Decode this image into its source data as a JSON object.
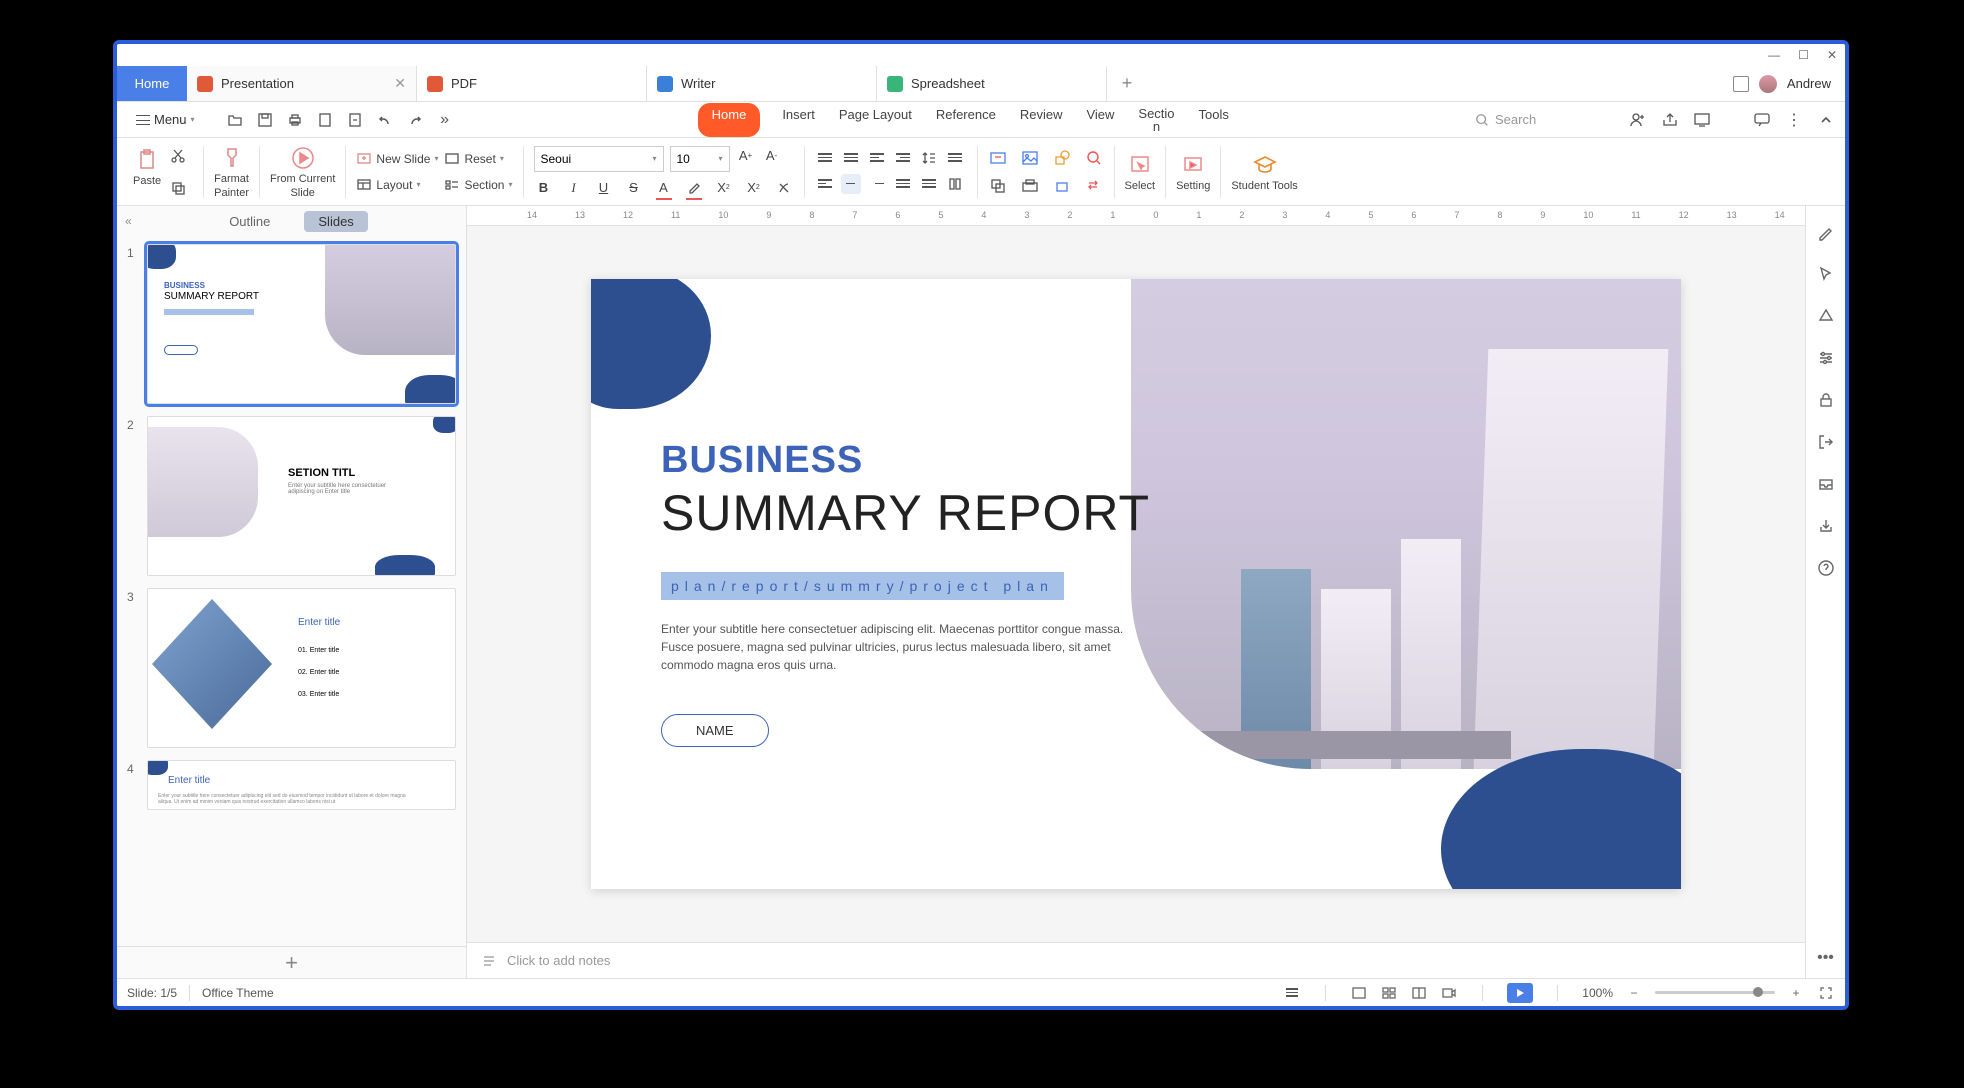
{
  "window": {
    "user": "Andrew"
  },
  "tabs": {
    "home": "Home",
    "docs": [
      {
        "label": "Presentation",
        "color": "#e05a3a"
      },
      {
        "label": "PDF",
        "color": "#e05a3a"
      },
      {
        "label": "Writer",
        "color": "#3a7fd8"
      },
      {
        "label": "Spreadsheet",
        "color": "#3ab57a"
      }
    ]
  },
  "menu": {
    "label": "Menu"
  },
  "ribbonTabs": {
    "home": "Home",
    "insert": "Insert",
    "pageLayout": "Page Layout",
    "reference": "Reference",
    "review": "Review",
    "view": "View",
    "section": "Sectio",
    "sectionN": "n",
    "tools": "Tools"
  },
  "search": {
    "placeholder": "Search"
  },
  "toolbar": {
    "paste": "Paste",
    "formatPainter": "Farmat",
    "formatPainter2": "Painter",
    "fromCurrent": "From Current",
    "fromCurrent2": "Slide",
    "newSlide": "New Slide",
    "reset": "Reset",
    "layout": "Layout",
    "section": "Section",
    "font": "Seoui",
    "size": "10",
    "select": "Select",
    "setting": "Setting",
    "studentTools": "Student Tools"
  },
  "leftPanel": {
    "outline": "Outline",
    "slides": "Slides",
    "t2_title": "SETION TITL",
    "t2_sub": "Enter your subtitle here consectetuer adipiscing on Enter title",
    "t3_title": "Enter title",
    "t3_i1": "01.",
    "t3_i2": "02.",
    "t3_i3": "03.",
    "t3_lbl": "Enter title",
    "t4_title": "Enter title"
  },
  "slide": {
    "business": "BUSINESS",
    "summary": "SUMMARY REPORT",
    "tag": "plan/report/summry/project plan",
    "para": "Enter your subtitle here consectetuer adipiscing elit. Maecenas porttitor congue massa. Fusce posuere, magna sed pulvinar ultricies, purus lectus malesuada libero, sit amet commodo magna eros quis urna.",
    "name": "NAME"
  },
  "notes": {
    "placeholder": "Click to add notes"
  },
  "status": {
    "slide": "Slide: 1/5",
    "theme": "Office Theme",
    "zoom": "100%"
  },
  "ruler": [
    "14",
    "13",
    "12",
    "11",
    "10",
    "9",
    "8",
    "7",
    "6",
    "5",
    "4",
    "3",
    "2",
    "1",
    "0",
    "1",
    "2",
    "3",
    "4",
    "5",
    "6",
    "7",
    "8",
    "9",
    "10",
    "11",
    "12",
    "13",
    "14"
  ]
}
